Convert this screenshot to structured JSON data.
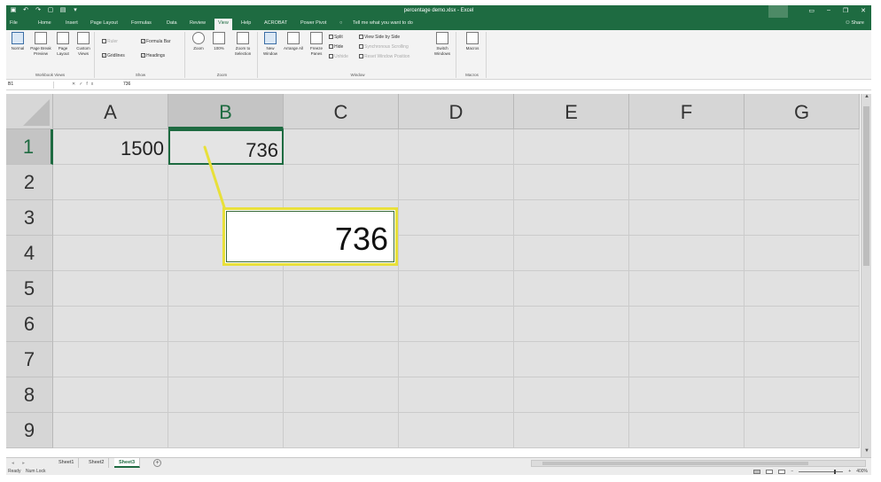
{
  "window": {
    "title": "percentage demo.xlsx - Excel",
    "share_label": "Share"
  },
  "ribbon_tabs": [
    "File",
    "Home",
    "Insert",
    "Page Layout",
    "Formulas",
    "Data",
    "Review",
    "View",
    "Help",
    "ACROBAT",
    "Power Pivot"
  ],
  "active_tab": "View",
  "tell_me": "Tell me what you want to do",
  "ribbon": {
    "workbook_views": {
      "label": "Workbook Views",
      "normal": "Normal",
      "page_break": "Page Break Preview",
      "page_layout": "Page Layout",
      "custom_views": "Custom Views"
    },
    "show": {
      "label": "Show",
      "ruler": "Ruler",
      "formula_bar": "Formula Bar",
      "gridlines": "Gridlines",
      "headings": "Headings"
    },
    "zoom": {
      "label": "Zoom",
      "zoom": "Zoom",
      "hundred": "100%",
      "to_selection": "Zoom to Selection"
    },
    "window": {
      "label": "Window",
      "new_window": "New Window",
      "arrange_all": "Arrange All",
      "freeze_panes": "Freeze Panes",
      "split": "Split",
      "hide": "Hide",
      "unhide": "Unhide",
      "side_by_side": "View Side by Side",
      "sync_scroll": "Synchronous Scrolling",
      "reset_position": "Reset Window Position",
      "switch_windows": "Switch Windows"
    },
    "macros": {
      "label": "Macros",
      "macros": "Macros"
    }
  },
  "formula_bar": {
    "name_box": "B1",
    "value": "736"
  },
  "columns": [
    "A",
    "B",
    "C",
    "D",
    "E",
    "F",
    "G"
  ],
  "rows": [
    "1",
    "2",
    "3",
    "4",
    "5",
    "6",
    "7",
    "8",
    "9"
  ],
  "cells": {
    "A1": "1500",
    "B1": "736"
  },
  "selected_cell": "B1",
  "callout_value": "736",
  "sheets": [
    "Sheet1",
    "Sheet2",
    "Sheet3"
  ],
  "active_sheet": "Sheet3",
  "status": {
    "ready": "Ready",
    "num_lock": "Num Lock",
    "zoom": "400%"
  }
}
